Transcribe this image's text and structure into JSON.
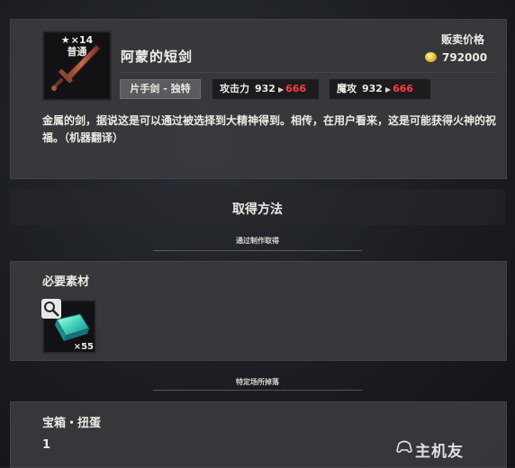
{
  "item": {
    "rarity_count": "×14",
    "rarity_label": "普通",
    "name": "阿蒙的短剑",
    "type_tag": "片手剑 - 独特",
    "sell_label": "贩卖价格",
    "sell_price": "792000",
    "stats": [
      {
        "label": "攻击力",
        "base": "932",
        "upgraded": "666"
      },
      {
        "label": "魔攻",
        "base": "932",
        "upgraded": "666"
      }
    ],
    "description": "金属的剑，据说这是可以通过被选择到大精神得到。相传，在用户看来，这是可能获得火神的祝福。（机器翻译）"
  },
  "acquisition": {
    "title": "取得方法",
    "craft_label": "通过制作取得",
    "materials_title": "必要素材",
    "material_count": "×55",
    "drop_label": "特定场所掉落",
    "location_name": "宝箱・扭蛋",
    "location_count": "1"
  },
  "watermark": "主机友",
  "colors": {
    "stat_up": "#ff3b3b",
    "panel": "#3a3a3e",
    "coin": "#f0c440"
  },
  "icons": [
    "sword-icon",
    "star-icon",
    "coin-icon",
    "stat-arrow-icon",
    "magnifier-icon",
    "ingot-icon",
    "gamepad-icon"
  ]
}
